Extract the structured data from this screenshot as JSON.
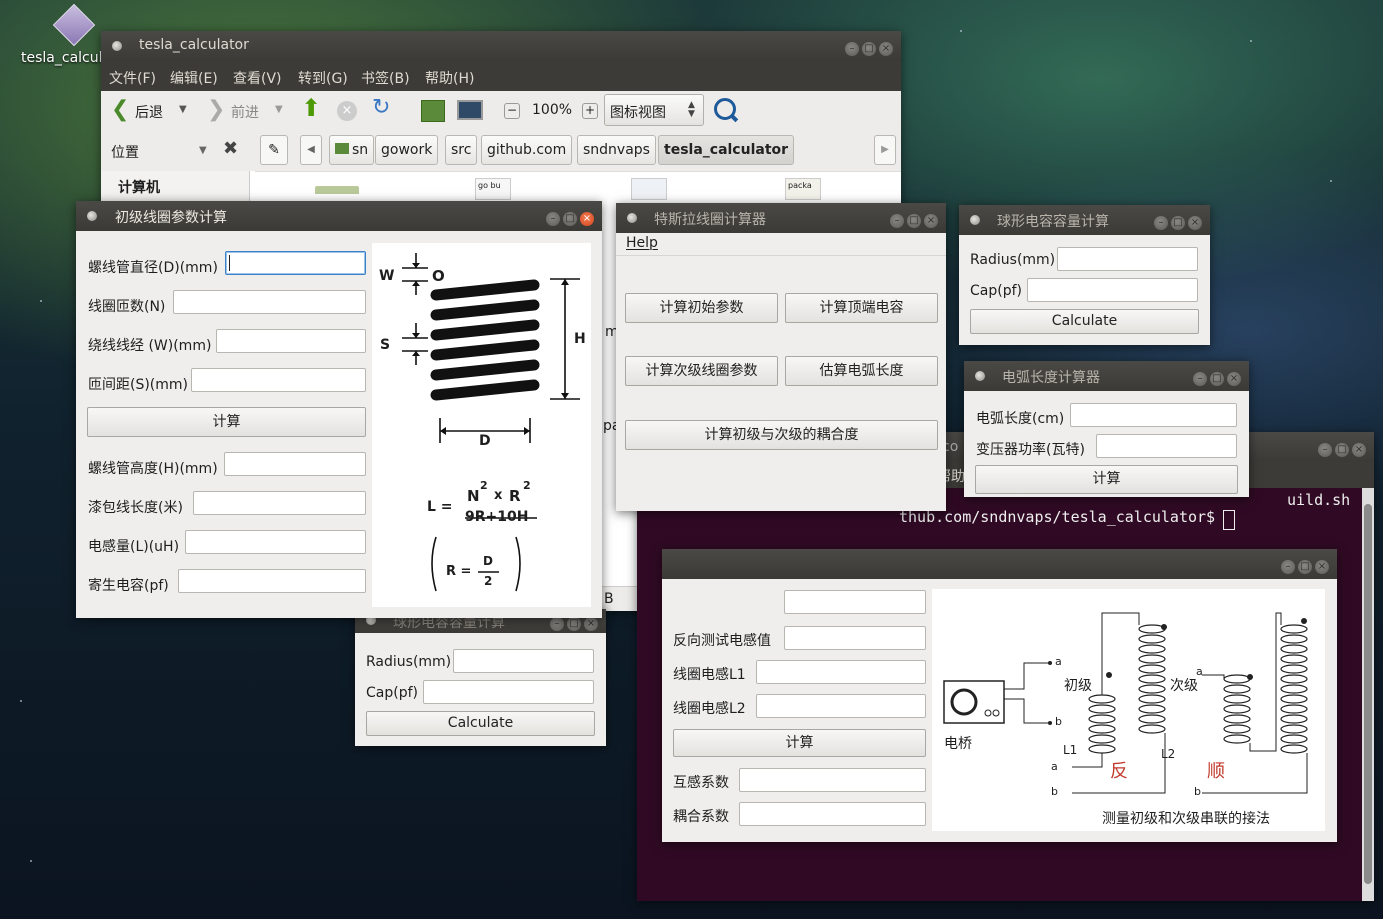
{
  "desktop": {
    "icon_label": "tesla_calcul"
  },
  "file_manager": {
    "title": "tesla_calculator",
    "menu": [
      "文件(F)",
      "编辑(E)",
      "查看(V)",
      "转到(G)",
      "书签(B)",
      "帮助(H)"
    ],
    "back_label": "后退",
    "forward_label": "前进",
    "zoom": "100%",
    "view_mode": "图标视图",
    "location_label": "位置",
    "breadcrumbs": [
      "sn",
      "gowork",
      "src",
      "github.com",
      "sndnvaps",
      "tesla_calculator"
    ],
    "sidebar_heading": "计算机",
    "file_labels": [
      "go bu",
      "packa"
    ],
    "partial_m": "m",
    "partial_pa": "pa",
    "status_partial": "B"
  },
  "primary_coil": {
    "title": "初级线圈参数计算",
    "fields": [
      {
        "label": "螺线管直径(D)(mm)",
        "value": ""
      },
      {
        "label": "线圈匝数(N)",
        "value": ""
      },
      {
        "label": "绕线线经 (W)(mm)",
        "value": ""
      },
      {
        "label": "匝间距(S)(mm)",
        "value": ""
      }
    ],
    "calc_button": "计算",
    "outputs": [
      {
        "label": "螺线管高度(H)(mm)",
        "value": ""
      },
      {
        "label": "漆包线长度(米)",
        "value": ""
      },
      {
        "label": "电感量(L)(uH)",
        "value": ""
      },
      {
        "label": "寄生电容(pf)",
        "value": ""
      }
    ],
    "diagram": {
      "w": "W",
      "s": "S",
      "h": "H",
      "d": "D",
      "o": "O",
      "formula_l": "L =",
      "formula_num_n": "N",
      "formula_num_r": "R",
      "formula_sup": "2",
      "formula_x": "x",
      "formula_den": "9R+10H",
      "r_eq": "R =",
      "r_num": "D",
      "r_den": "2"
    }
  },
  "tesla_main": {
    "title": "特斯拉线圈计算器",
    "menu_help": "Help",
    "buttons": [
      "计算初始参数",
      "计算顶端电容",
      "计算次级线圈参数",
      "估算电弧长度",
      "计算初级与次级的耦合度"
    ]
  },
  "sphere_cap_top": {
    "title": "球形电容容量计算",
    "radius_label": "Radius(mm)",
    "cap_label": "Cap(pf)",
    "radius_value": "",
    "cap_value": "",
    "calc_button": "Calculate"
  },
  "arc_length": {
    "title": "电弧长度计算器",
    "arc_label": "电弧长度(cm)",
    "power_label": "变压器功率(瓦特)",
    "arc_value": "",
    "power_value": "",
    "calc_button": "计算"
  },
  "terminal": {
    "line1_partial": "uild.sh",
    "line2_partial": "thub.com/sndnvaps/tesla_calculator$",
    "title_partial": "co",
    "help_partial": "帮助"
  },
  "sphere_cap_bottom": {
    "title": "球形电容容量计算",
    "radius_label": "Radius(mm)",
    "cap_label": "Cap(pf)",
    "radius_value": "",
    "cap_value": "",
    "calc_button": "Calculate"
  },
  "coupling": {
    "fields": [
      {
        "label": "反向测试电感值",
        "value": ""
      },
      {
        "label": "线圈电感L1",
        "value": ""
      },
      {
        "label": "线圈电感L2",
        "value": ""
      }
    ],
    "calc_button": "计算",
    "outputs": [
      {
        "label": "互感系数",
        "value": ""
      },
      {
        "label": "耦合系数",
        "value": ""
      }
    ],
    "diagram": {
      "bridge": "电桥",
      "primary": "初级",
      "secondary": "次级",
      "l1": "L1",
      "l2": "L2",
      "a": "a",
      "b": "b",
      "reverse": "反",
      "forward": "顺",
      "caption": "测量初级和次级串联的接法"
    }
  },
  "colors": {
    "titlebar": "#3c3b37",
    "window_bg": "#efeeed",
    "close_accent": "#d4471c",
    "focus": "#3d82c8",
    "terminal_bg": "#300a24",
    "diagram_red": "#c0392b"
  }
}
